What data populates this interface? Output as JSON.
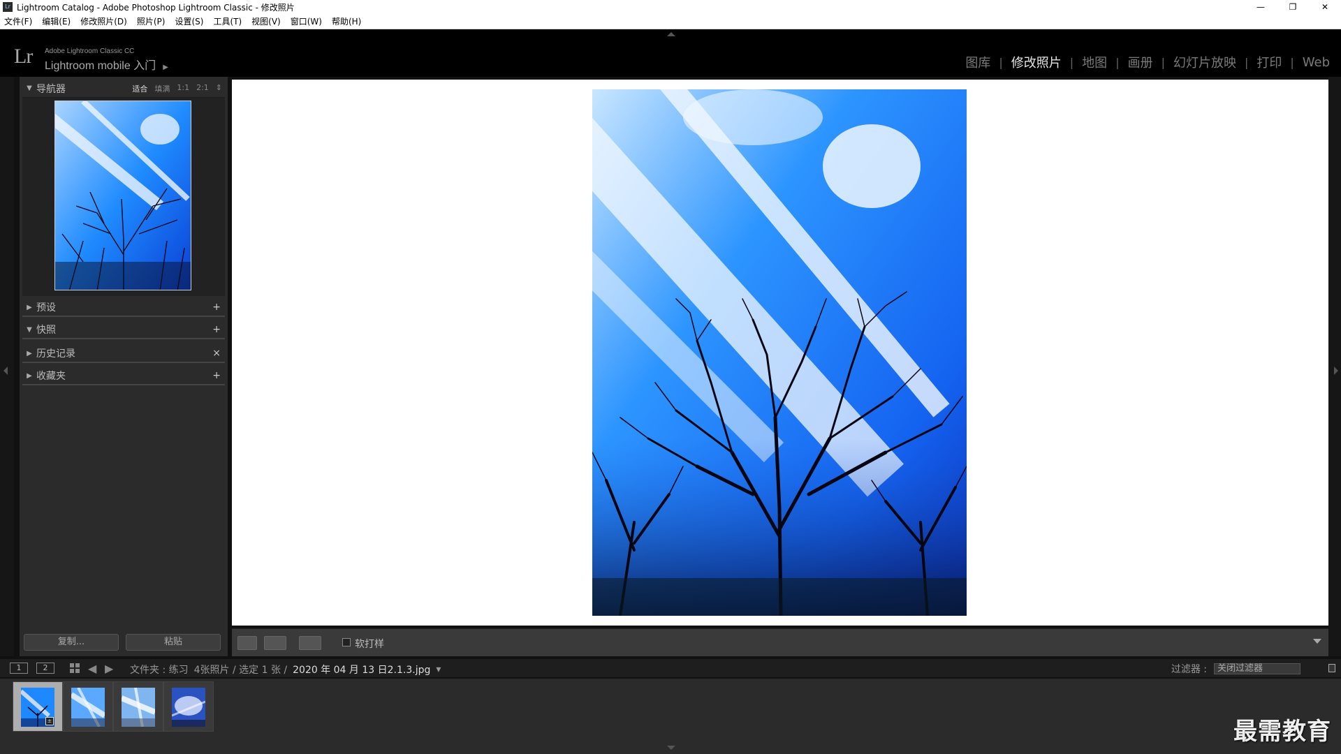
{
  "window": {
    "title": "Lightroom Catalog - Adobe Photoshop Lightroom Classic - 修改照片",
    "app_icon": "Lr",
    "controls": [
      "—",
      "❐",
      "✕"
    ]
  },
  "menu": [
    "文件(F)",
    "编辑(E)",
    "修改照片(D)",
    "照片(P)",
    "设置(S)",
    "工具(T)",
    "视图(V)",
    "窗口(W)",
    "帮助(H)"
  ],
  "identity": {
    "logo": "Lr",
    "small": "Adobe Lightroom Classic CC",
    "main": "Lightroom mobile 入门"
  },
  "modules": [
    {
      "label": "图库",
      "active": false
    },
    {
      "label": "修改照片",
      "active": true
    },
    {
      "label": "地图",
      "active": false
    },
    {
      "label": "画册",
      "active": false
    },
    {
      "label": "幻灯片放映",
      "active": false
    },
    {
      "label": "打印",
      "active": false
    },
    {
      "label": "Web",
      "active": false
    }
  ],
  "module_separator": "|",
  "left_panel": {
    "navigator": {
      "title": "导航器",
      "options": [
        "适合",
        "填满",
        "1:1",
        "2:1"
      ],
      "selected": "适合"
    },
    "sections": [
      {
        "title": "预设",
        "action": "+",
        "expanded": false
      },
      {
        "title": "快照",
        "action": "+",
        "expanded": true
      },
      {
        "title": "历史记录",
        "action": "×",
        "expanded": false
      },
      {
        "title": "收藏夹",
        "action": "+",
        "expanded": false
      }
    ],
    "copy_button": "复制...",
    "paste_button": "粘贴"
  },
  "toolbar": {
    "soft_proof_label": "软打样"
  },
  "filmstrip_bar": {
    "pages": [
      "1",
      "2"
    ],
    "source": "文件夹 : 练习",
    "count": "4张照片 / 选定 1 张 /",
    "filename": "2020 年 04 月 13 日2.1.3.jpg",
    "filter_label": "过滤器 :",
    "filter_value": "关闭过滤器"
  },
  "filmstrip": {
    "count": 4,
    "selected_index": 0
  },
  "watermark": "最需教育",
  "colors": {
    "sky": "#1e88ff",
    "accent_active": "#e6e6e6",
    "panel": "#2b2b2b"
  }
}
